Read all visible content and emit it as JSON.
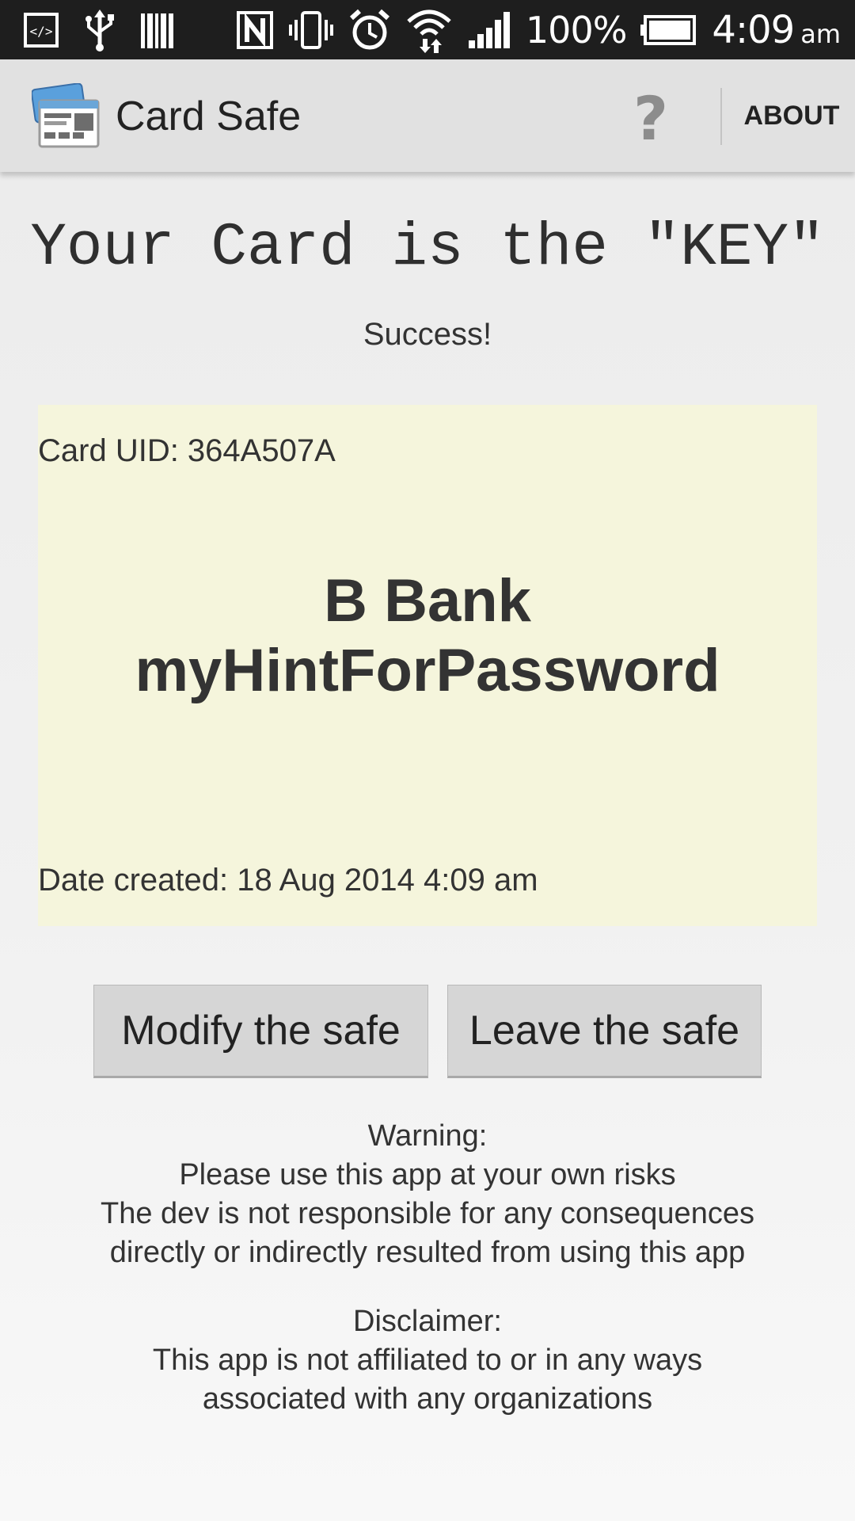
{
  "status_bar": {
    "left_icons": [
      "developer-code-icon",
      "usb-icon",
      "barcode-icon"
    ],
    "right_icons": [
      "nfc-icon",
      "vibrate-icon",
      "alarm-icon",
      "wifi-icon",
      "signal-icon"
    ],
    "battery_percent": "100%",
    "battery_level": 1.0,
    "time": "4:09",
    "ampm": "am"
  },
  "action_bar": {
    "app_icon": "card-safe-logo-icon",
    "title": "Card Safe",
    "help_icon": "help-question-icon",
    "help_glyph": "?",
    "about_label": "ABOUT"
  },
  "main": {
    "headline": "Your Card is the \"KEY\"",
    "status": "Success!",
    "card": {
      "uid_text": "Card UID: 364A507A",
      "name": "B Bank",
      "hint": "myHintForPassword",
      "date_text": "Date created: 18 Aug 2014 4:09 am",
      "background": "#f5f5dc"
    },
    "buttons": {
      "modify_label": "Modify the safe",
      "leave_label": "Leave the safe"
    },
    "warning": {
      "title": "Warning:",
      "lines": [
        "Please use this app at your own risks",
        "The dev is not responsible for any consequences",
        "directly or indirectly resulted from using this app"
      ]
    },
    "disclaimer": {
      "title": "Disclaimer:",
      "lines": [
        "This app is not affiliated to or in any ways",
        "associated with any organizations"
      ]
    }
  }
}
